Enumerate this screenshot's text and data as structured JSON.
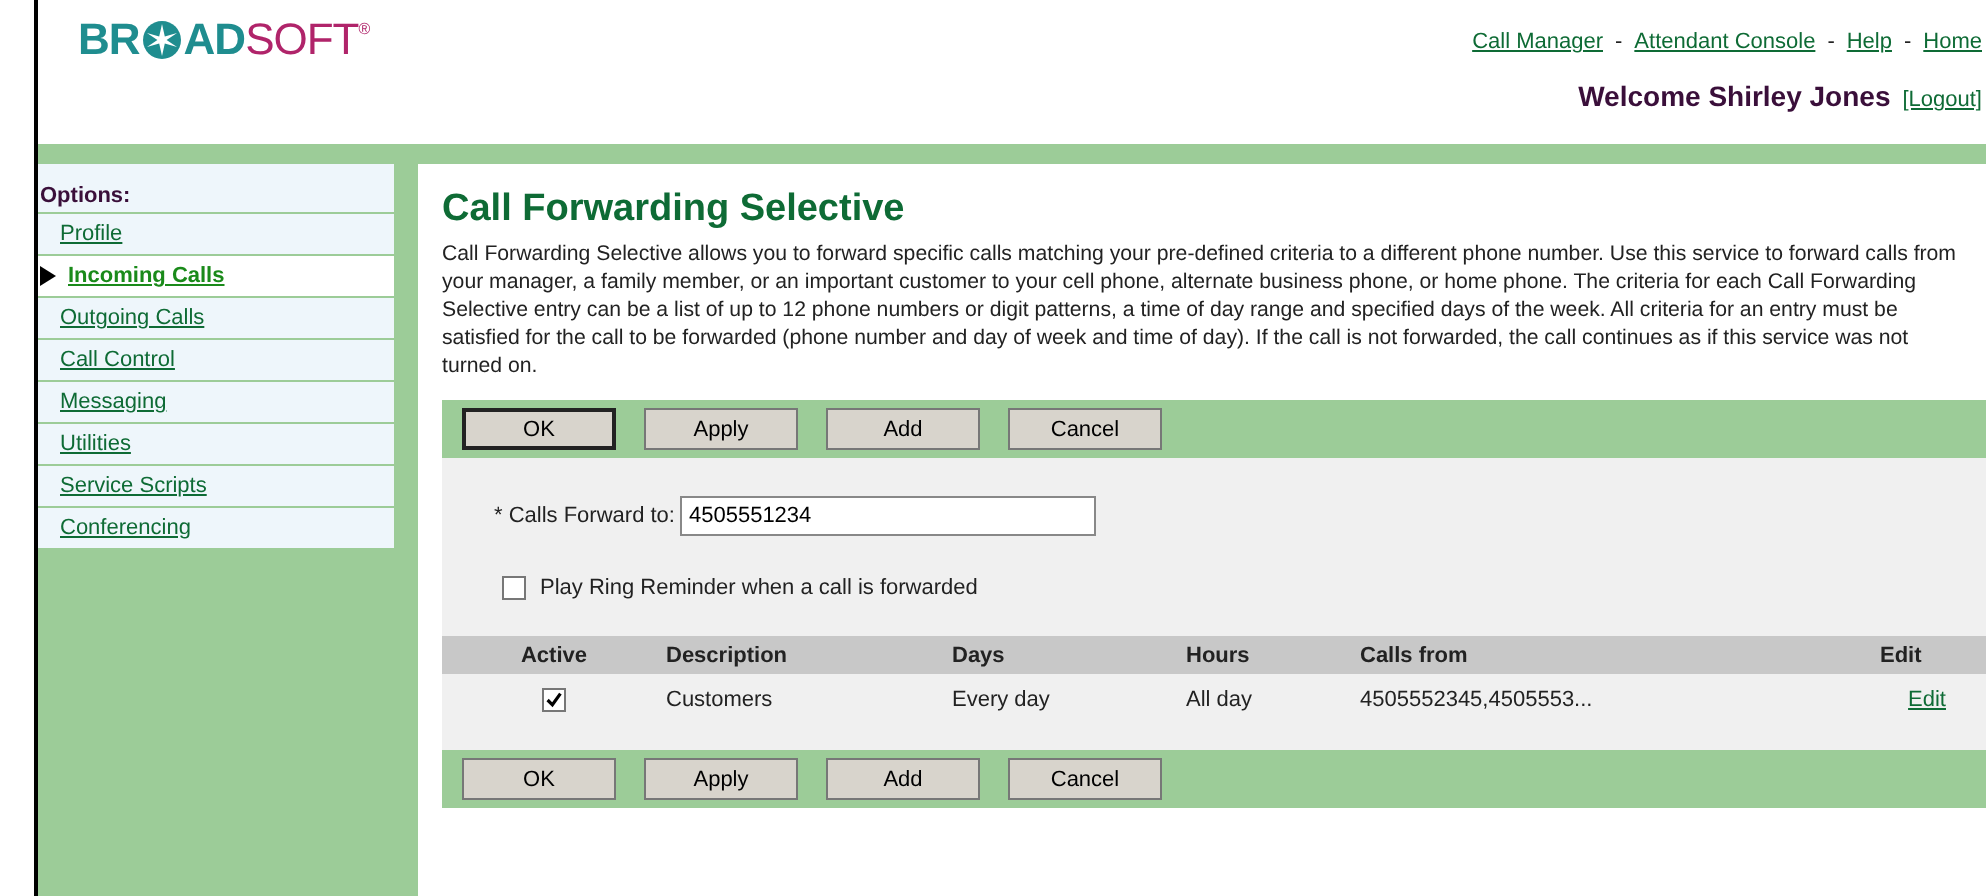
{
  "logo": {
    "part_1": "BR",
    "part_2": "AD",
    "part_3": "SOFT",
    "mark": "®"
  },
  "header": {
    "links": [
      "Call Manager",
      "Attendant Console",
      "Help",
      "Home"
    ],
    "separator": "-",
    "welcome": "Welcome Shirley Jones",
    "logout": "[Logout]"
  },
  "sidebar": {
    "title": "Options:",
    "items": [
      {
        "label": "Profile",
        "selected": false
      },
      {
        "label": "Incoming Calls",
        "selected": true
      },
      {
        "label": "Outgoing Calls",
        "selected": false
      },
      {
        "label": "Call Control",
        "selected": false
      },
      {
        "label": "Messaging",
        "selected": false
      },
      {
        "label": "Utilities",
        "selected": false
      },
      {
        "label": "Service Scripts",
        "selected": false
      },
      {
        "label": "Conferencing",
        "selected": false
      }
    ]
  },
  "page": {
    "title": "Call Forwarding Selective",
    "description": "Call Forwarding Selective allows you to forward specific calls matching your pre-defined criteria to a different phone number. Use this service to forward calls from your manager, a family member, or an important customer to your cell phone, alternate business phone, or home phone. The criteria for each Call Forwarding Selective entry can be a list of up to 12 phone numbers or digit patterns, a time of day range and specified days of the week. All criteria for an entry must be satisfied for the call to be forwarded (phone number and day of week and time of day). If the call is not forwarded, the call continues as if this service was not turned on."
  },
  "top_buttons": [
    {
      "label": "OK",
      "default": true
    },
    {
      "label": "Apply",
      "default": false
    },
    {
      "label": "Add",
      "default": false
    },
    {
      "label": "Cancel",
      "default": false
    }
  ],
  "form": {
    "forward_label": "* Calls Forward to:",
    "forward_value": "4505551234",
    "reminder": {
      "label": "Play Ring Reminder when a call is forwarded",
      "checked": false
    }
  },
  "table": {
    "columns": [
      "Active",
      "Description",
      "Days",
      "Hours",
      "Calls from",
      "Edit"
    ],
    "rows": [
      {
        "active": true,
        "description": "Customers",
        "days": "Every day",
        "hours": "All day",
        "calls_from": "4505552345,4505553...",
        "edit": "Edit"
      }
    ]
  },
  "bottom_buttons": [
    {
      "label": "OK",
      "default": false
    },
    {
      "label": "Apply",
      "default": false
    },
    {
      "label": "Add",
      "default": false
    },
    {
      "label": "Cancel",
      "default": false
    }
  ]
}
